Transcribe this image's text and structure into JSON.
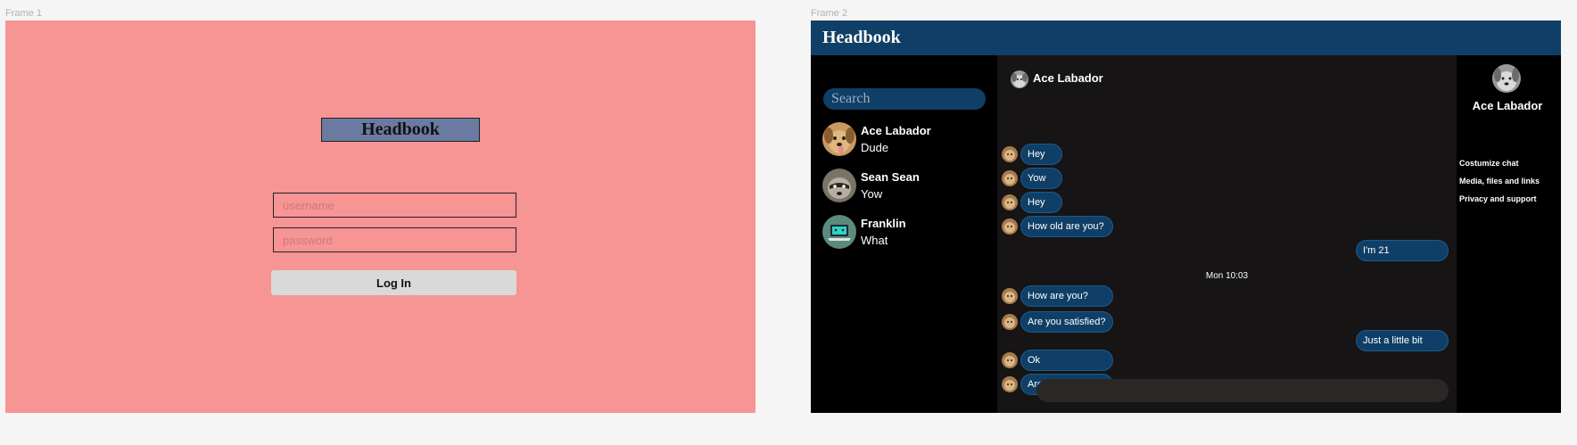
{
  "frames": {
    "frame1_label": "Frame 1",
    "frame2_label": "Frame 2"
  },
  "login": {
    "logo": "Headbook",
    "username_placeholder": "username",
    "password_placeholder": "password",
    "login_button": "Log In",
    "background": "#f79494",
    "logo_background": "#6b7aa0"
  },
  "app": {
    "logo": "Headbook",
    "header_color": "#0f3f66",
    "search_placeholder": "Search",
    "contacts": [
      {
        "name": "Ace Labador",
        "preview": "Dude",
        "avatar": "dog-avatar"
      },
      {
        "name": "Sean Sean",
        "preview": "Yow",
        "avatar": "raccoon-avatar"
      },
      {
        "name": "Franklin",
        "preview": "What",
        "avatar": "laptop-avatar"
      }
    ],
    "chat": {
      "contact_name": "Ace Labador",
      "messages": [
        {
          "from": "them",
          "text": "Hey"
        },
        {
          "from": "them",
          "text": "Yow"
        },
        {
          "from": "them",
          "text": "Hey"
        },
        {
          "from": "them",
          "text": "How old are you?"
        },
        {
          "from": "me",
          "text": "I'm 21"
        },
        {
          "from": "them",
          "text": "How are you?"
        },
        {
          "from": "them",
          "text": "Are you satisfied?"
        },
        {
          "from": "me",
          "text": "Just a little bit"
        },
        {
          "from": "them",
          "text": "Ok"
        },
        {
          "from": "them",
          "text": "Are satisfied?"
        }
      ],
      "date_separator": "Mon 10:03",
      "compose_placeholder": ""
    },
    "info_panel": {
      "name": "Ace Labador",
      "links": [
        "Costumize chat",
        "Media, files and links",
        "Privacy and support"
      ]
    }
  }
}
